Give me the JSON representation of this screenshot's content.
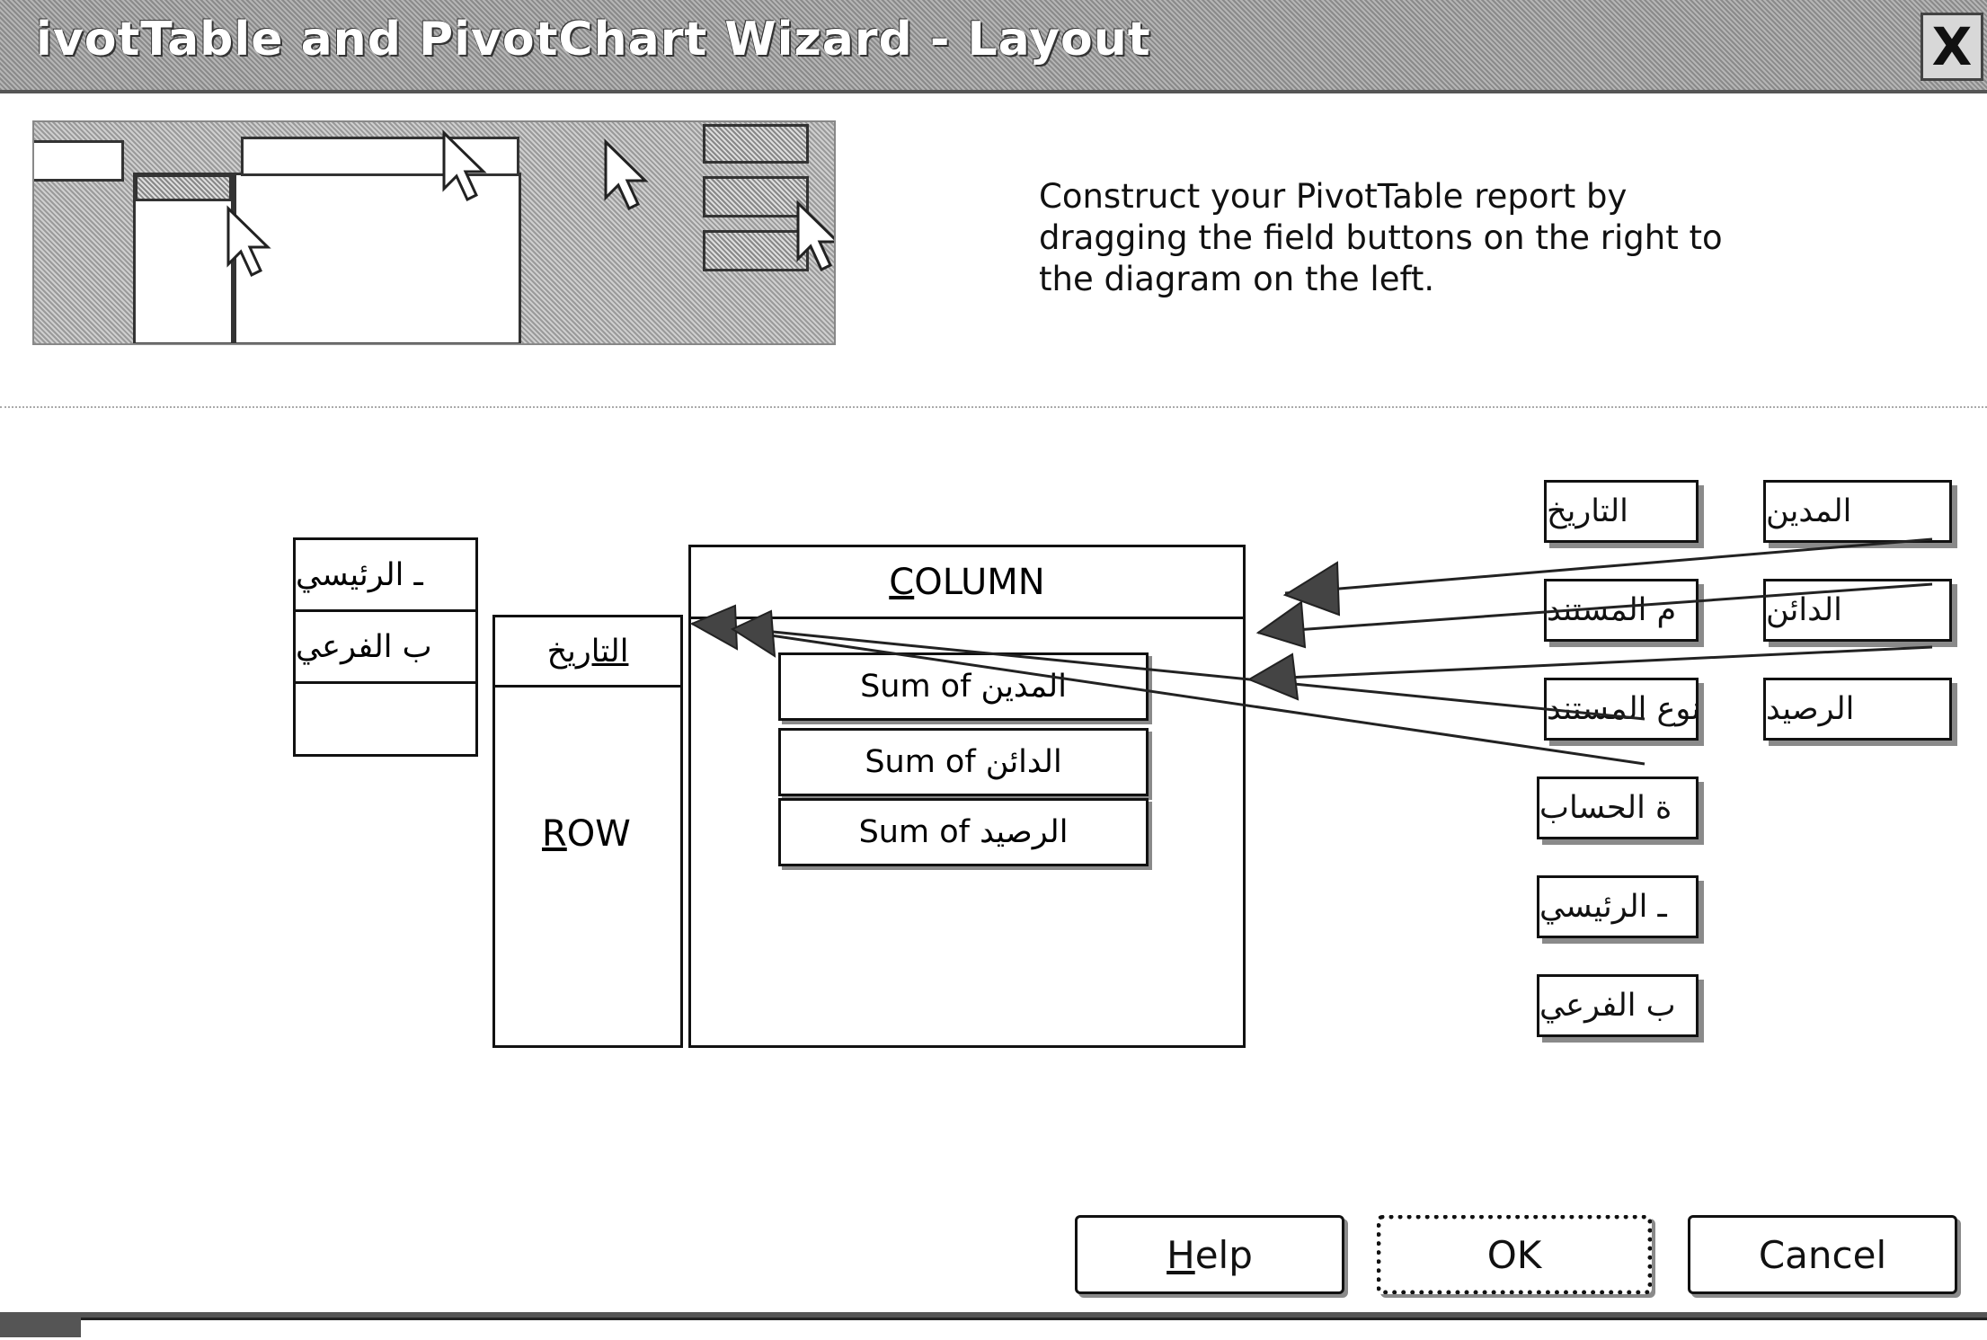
{
  "window": {
    "title": "ivotTable and PivotChart Wizard - Layout",
    "close_label": "X"
  },
  "instructions": "Construct your PivotTable report by dragging the field buttons on the right to the diagram on the left.",
  "layout": {
    "page_fields": [
      "ـ الرئيسي",
      "ب الفرعي"
    ],
    "row": {
      "field": "التاريخ",
      "label_prefix": "",
      "label_accel": "R",
      "label_rest": "OW"
    },
    "column": {
      "label_accel": "C",
      "label_rest": "OLUMN"
    },
    "data_items": [
      "Sum of المدين",
      "Sum of الدائن",
      "Sum of الرصيد"
    ]
  },
  "field_list": {
    "col1": [
      "التاريخ",
      "م المستند",
      "نوع المستند",
      "ة الحساب",
      "ـ الرئيسي",
      "ب الفرعي"
    ],
    "col2": [
      "المدين",
      "الدائن",
      "الرصيد"
    ]
  },
  "buttons": {
    "help": {
      "accel": "H",
      "rest": "elp"
    },
    "ok": "OK",
    "cancel": "Cancel"
  }
}
